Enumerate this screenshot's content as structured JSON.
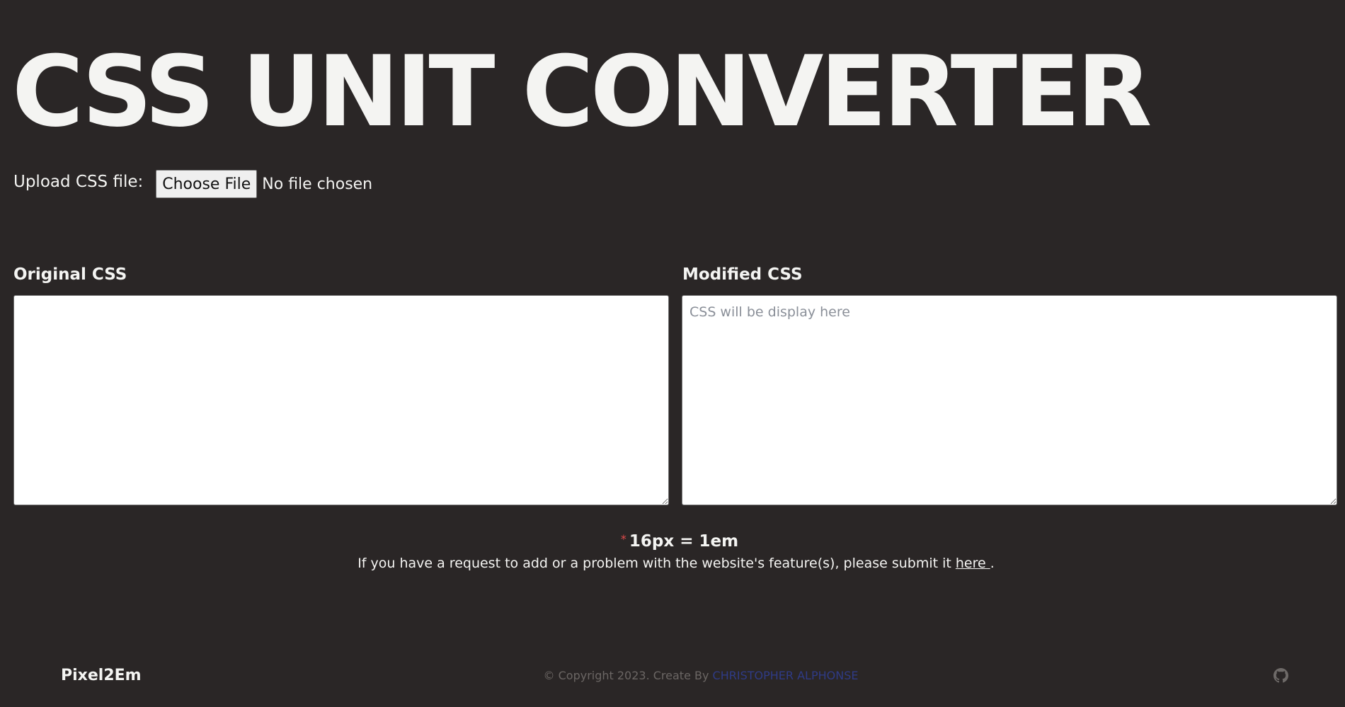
{
  "header": {
    "title": "CSS UNIT CONVERTER"
  },
  "upload": {
    "label": "Upload CSS file:",
    "button_label": "Choose File",
    "status": "No file chosen"
  },
  "panels": {
    "original": {
      "label": "Original CSS",
      "value": "",
      "placeholder": ""
    },
    "modified": {
      "label": "Modified CSS",
      "value": "",
      "placeholder": "CSS will be display here"
    }
  },
  "note": {
    "asterisk": "*",
    "ratio": "16px = 1em",
    "request_text": "If you have a request to add or a problem with the website's feature(s), please submit it ",
    "request_link": "here ",
    "request_end": "."
  },
  "footer": {
    "brand": "Pixel2Em",
    "copyright": "© Copyright 2023. Create By ",
    "author": "CHRISTOPHER ALPHONSE",
    "icon": "github-icon"
  },
  "colors": {
    "background": "#2a2626",
    "text": "#f4f4f2",
    "asterisk": "#e24b4b",
    "author_link": "#2f3b86",
    "muted": "#6b6664"
  }
}
